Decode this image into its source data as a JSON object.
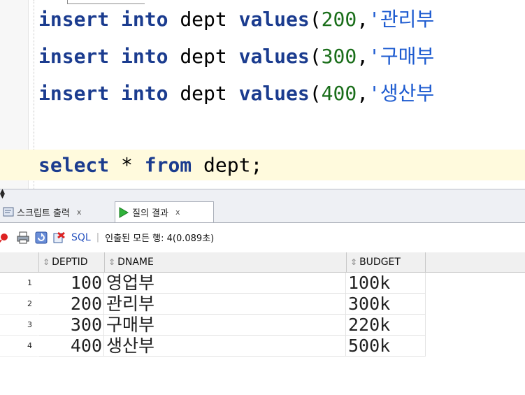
{
  "editor": {
    "lines": [
      {
        "kw1": "insert",
        "kw2": "into",
        "table": "dept",
        "kw3": "values",
        "open": "(",
        "num": "200",
        "comma": ",",
        "str": "'관리부"
      },
      {
        "kw1": "insert",
        "kw2": "into",
        "table": "dept",
        "kw3": "values",
        "open": "(",
        "num": "300",
        "comma": ",",
        "str": "'구매부"
      },
      {
        "kw1": "insert",
        "kw2": "into",
        "table": "dept",
        "kw3": "values",
        "open": "(",
        "num": "400",
        "comma": ",",
        "str": "'생산부"
      }
    ],
    "select_line": {
      "kw1": "select",
      "star": " * ",
      "kw2": "from",
      "table": " dept;"
    }
  },
  "tabs": [
    {
      "label": "스크립트 출력",
      "close": "x",
      "icon": "script-output-icon"
    },
    {
      "label": "질의 결과",
      "close": "x",
      "icon": "run-query-icon"
    }
  ],
  "toolbar": {
    "sql_label": "SQL",
    "separator": "|",
    "status": "인출된 모든 행: 4(0.089초)",
    "icons": [
      "pin-icon",
      "print-icon",
      "refresh-icon",
      "export-icon"
    ]
  },
  "grid": {
    "columns": [
      "DEPTID",
      "DNAME",
      "BUDGET"
    ],
    "rows": [
      {
        "num": "1",
        "deptid": "100",
        "dname": "영업부",
        "budget": "100k"
      },
      {
        "num": "2",
        "deptid": "200",
        "dname": "관리부",
        "budget": "300k"
      },
      {
        "num": "3",
        "deptid": "300",
        "dname": "구매부",
        "budget": "220k"
      },
      {
        "num": "4",
        "deptid": "400",
        "dname": "생산부",
        "budget": "500k"
      }
    ]
  },
  "colors": {
    "keyword": "#1b3c8f",
    "number": "#1a6e1a",
    "string": "#1d5bd0",
    "current_line": "#fffadd"
  }
}
